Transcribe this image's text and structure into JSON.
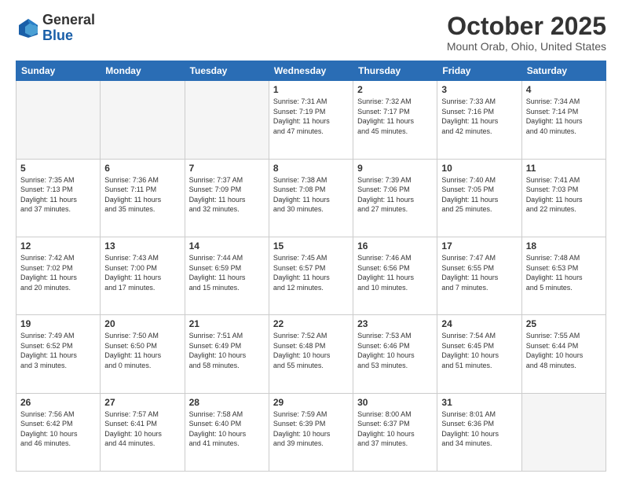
{
  "header": {
    "logo_line1": "General",
    "logo_line2": "Blue",
    "month_title": "October 2025",
    "location": "Mount Orab, Ohio, United States"
  },
  "weekdays": [
    "Sunday",
    "Monday",
    "Tuesday",
    "Wednesday",
    "Thursday",
    "Friday",
    "Saturday"
  ],
  "weeks": [
    [
      {
        "day": "",
        "info": ""
      },
      {
        "day": "",
        "info": ""
      },
      {
        "day": "",
        "info": ""
      },
      {
        "day": "1",
        "info": "Sunrise: 7:31 AM\nSunset: 7:19 PM\nDaylight: 11 hours\nand 47 minutes."
      },
      {
        "day": "2",
        "info": "Sunrise: 7:32 AM\nSunset: 7:17 PM\nDaylight: 11 hours\nand 45 minutes."
      },
      {
        "day": "3",
        "info": "Sunrise: 7:33 AM\nSunset: 7:16 PM\nDaylight: 11 hours\nand 42 minutes."
      },
      {
        "day": "4",
        "info": "Sunrise: 7:34 AM\nSunset: 7:14 PM\nDaylight: 11 hours\nand 40 minutes."
      }
    ],
    [
      {
        "day": "5",
        "info": "Sunrise: 7:35 AM\nSunset: 7:13 PM\nDaylight: 11 hours\nand 37 minutes."
      },
      {
        "day": "6",
        "info": "Sunrise: 7:36 AM\nSunset: 7:11 PM\nDaylight: 11 hours\nand 35 minutes."
      },
      {
        "day": "7",
        "info": "Sunrise: 7:37 AM\nSunset: 7:09 PM\nDaylight: 11 hours\nand 32 minutes."
      },
      {
        "day": "8",
        "info": "Sunrise: 7:38 AM\nSunset: 7:08 PM\nDaylight: 11 hours\nand 30 minutes."
      },
      {
        "day": "9",
        "info": "Sunrise: 7:39 AM\nSunset: 7:06 PM\nDaylight: 11 hours\nand 27 minutes."
      },
      {
        "day": "10",
        "info": "Sunrise: 7:40 AM\nSunset: 7:05 PM\nDaylight: 11 hours\nand 25 minutes."
      },
      {
        "day": "11",
        "info": "Sunrise: 7:41 AM\nSunset: 7:03 PM\nDaylight: 11 hours\nand 22 minutes."
      }
    ],
    [
      {
        "day": "12",
        "info": "Sunrise: 7:42 AM\nSunset: 7:02 PM\nDaylight: 11 hours\nand 20 minutes."
      },
      {
        "day": "13",
        "info": "Sunrise: 7:43 AM\nSunset: 7:00 PM\nDaylight: 11 hours\nand 17 minutes."
      },
      {
        "day": "14",
        "info": "Sunrise: 7:44 AM\nSunset: 6:59 PM\nDaylight: 11 hours\nand 15 minutes."
      },
      {
        "day": "15",
        "info": "Sunrise: 7:45 AM\nSunset: 6:57 PM\nDaylight: 11 hours\nand 12 minutes."
      },
      {
        "day": "16",
        "info": "Sunrise: 7:46 AM\nSunset: 6:56 PM\nDaylight: 11 hours\nand 10 minutes."
      },
      {
        "day": "17",
        "info": "Sunrise: 7:47 AM\nSunset: 6:55 PM\nDaylight: 11 hours\nand 7 minutes."
      },
      {
        "day": "18",
        "info": "Sunrise: 7:48 AM\nSunset: 6:53 PM\nDaylight: 11 hours\nand 5 minutes."
      }
    ],
    [
      {
        "day": "19",
        "info": "Sunrise: 7:49 AM\nSunset: 6:52 PM\nDaylight: 11 hours\nand 3 minutes."
      },
      {
        "day": "20",
        "info": "Sunrise: 7:50 AM\nSunset: 6:50 PM\nDaylight: 11 hours\nand 0 minutes."
      },
      {
        "day": "21",
        "info": "Sunrise: 7:51 AM\nSunset: 6:49 PM\nDaylight: 10 hours\nand 58 minutes."
      },
      {
        "day": "22",
        "info": "Sunrise: 7:52 AM\nSunset: 6:48 PM\nDaylight: 10 hours\nand 55 minutes."
      },
      {
        "day": "23",
        "info": "Sunrise: 7:53 AM\nSunset: 6:46 PM\nDaylight: 10 hours\nand 53 minutes."
      },
      {
        "day": "24",
        "info": "Sunrise: 7:54 AM\nSunset: 6:45 PM\nDaylight: 10 hours\nand 51 minutes."
      },
      {
        "day": "25",
        "info": "Sunrise: 7:55 AM\nSunset: 6:44 PM\nDaylight: 10 hours\nand 48 minutes."
      }
    ],
    [
      {
        "day": "26",
        "info": "Sunrise: 7:56 AM\nSunset: 6:42 PM\nDaylight: 10 hours\nand 46 minutes."
      },
      {
        "day": "27",
        "info": "Sunrise: 7:57 AM\nSunset: 6:41 PM\nDaylight: 10 hours\nand 44 minutes."
      },
      {
        "day": "28",
        "info": "Sunrise: 7:58 AM\nSunset: 6:40 PM\nDaylight: 10 hours\nand 41 minutes."
      },
      {
        "day": "29",
        "info": "Sunrise: 7:59 AM\nSunset: 6:39 PM\nDaylight: 10 hours\nand 39 minutes."
      },
      {
        "day": "30",
        "info": "Sunrise: 8:00 AM\nSunset: 6:37 PM\nDaylight: 10 hours\nand 37 minutes."
      },
      {
        "day": "31",
        "info": "Sunrise: 8:01 AM\nSunset: 6:36 PM\nDaylight: 10 hours\nand 34 minutes."
      },
      {
        "day": "",
        "info": ""
      }
    ]
  ]
}
